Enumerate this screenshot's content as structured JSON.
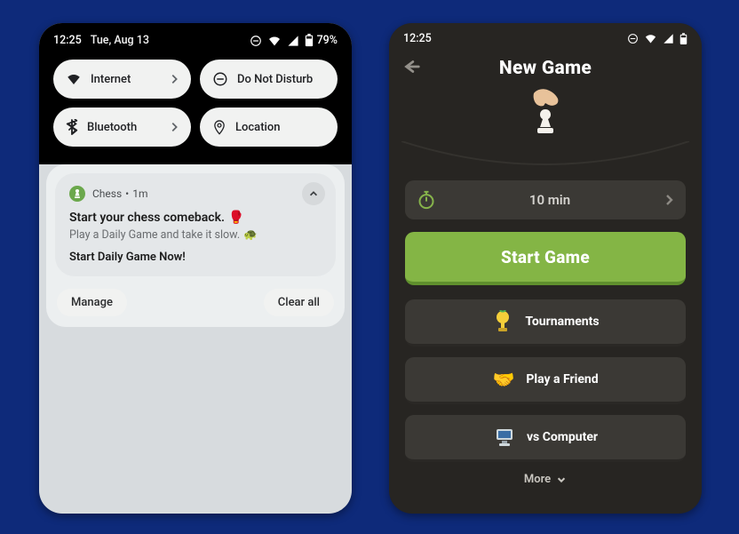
{
  "left": {
    "status": {
      "time": "12:25",
      "date": "Tue, Aug 13",
      "battery": "79%"
    },
    "quick_settings": {
      "internet": "Internet",
      "dnd": "Do Not Disturb",
      "bluetooth": "Bluetooth",
      "location": "Location"
    },
    "notification": {
      "app": "Chess",
      "age": "1m",
      "title": "Start your chess comeback.",
      "title_emoji": "🥊",
      "subtitle": "Play a Daily Game and take it slow.",
      "subtitle_emoji": "🐢",
      "action": "Start Daily Game Now!"
    },
    "footer": {
      "manage": "Manage",
      "clear_all": "Clear all"
    }
  },
  "right": {
    "status": {
      "time": "12:25"
    },
    "title": "New Game",
    "time_control": "10 min",
    "start": "Start Game",
    "options": {
      "tournaments": "Tournaments",
      "play_friend": "Play a Friend",
      "vs_computer": "vs Computer"
    },
    "more": "More"
  }
}
